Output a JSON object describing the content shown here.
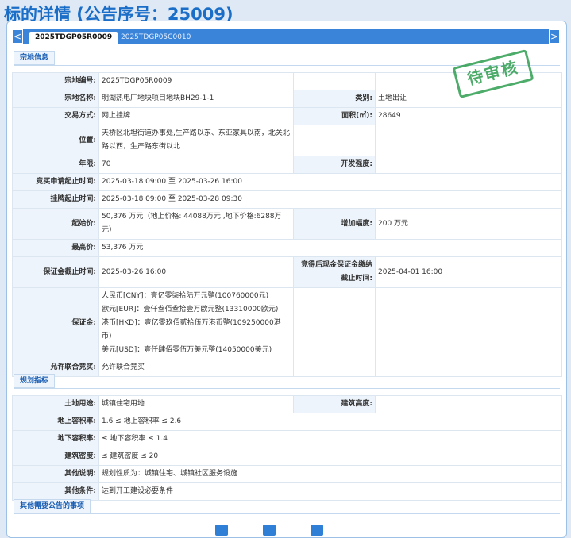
{
  "page_title": "标的详情 (公告序号：25009)",
  "tabs": [
    {
      "label": "2025TDGP05R0009",
      "active": true
    },
    {
      "label": "2025TDGP05C0010",
      "active": false
    }
  ],
  "nav": {
    "prev": "<",
    "next": ">"
  },
  "stamp": "待审核",
  "section1": {
    "title": "宗地信息",
    "plot_no_label": "宗地编号:",
    "plot_no": "2025TDGP05R0009",
    "plot_name_label": "宗地名称:",
    "plot_name": "明湖热电厂地块项目地块BH29-1-1",
    "category_label": "类别:",
    "category": "土地出让",
    "trade_mode_label": "交易方式:",
    "trade_mode": "网上挂牌",
    "area_label": "面积(㎡):",
    "area": "28649",
    "location_label": "位置:",
    "location": "天桥区北坦街道办事处,生产路以东、东亚家具以南，北关北路以西，生产路东街以北",
    "term_label": "年限:",
    "term": "70",
    "dev_intensity_label": "开发强度:",
    "dev_intensity": "",
    "apply_period_label": "竞买申请起止时间:",
    "apply_period": "2025-03-18 09:00 至 2025-03-26 16:00",
    "listing_period_label": "挂牌起止时间:",
    "listing_period": "2025-03-18 09:00 至 2025-03-28 09:30",
    "start_price_label": "起始价:",
    "start_price": "50,376 万元（地上价格: 44088万元 ,地下价格:6288万元）",
    "increment_label": "增加幅度:",
    "increment": "200 万元",
    "max_price_label": "最高价:",
    "max_price": "53,376 万元",
    "deposit_deadline_label": "保证金截止时间:",
    "deposit_deadline": "2025-03-26 16:00",
    "cash_deposit_label": "竞得后现金保证金缴纳截止时间:",
    "cash_deposit": "2025-04-01 16:00",
    "deposit_label": "保证金:",
    "deposit_lines": [
      "人民币[CNY]：壹亿零柒拾陆万元整(100760000元)",
      "欧元[EUR]：壹仟叁佰叁拾壹万欧元整(13310000欧元)",
      "港币[HKD]：壹亿零玖佰贰拾伍万港币整(109250000港币)",
      "美元[USD]：壹仟肆佰零伍万美元整(14050000美元)"
    ],
    "joint_bid_label": "允许联合竞买:",
    "joint_bid": "允许联合竞买"
  },
  "section2": {
    "title": "规划指标",
    "land_use_label": "土地用途:",
    "land_use": "城镇住宅用地",
    "height_label": "建筑高度:",
    "height": "",
    "above_far_label": "地上容积率:",
    "above_far": "1.6 ≤ 地上容积率 ≤ 2.6",
    "below_far_label": "地下容积率:",
    "below_far": "≤ 地下容积率 ≤ 1.4",
    "density_label": "建筑密度:",
    "density": "≤ 建筑密度 ≤ 20",
    "other_note_label": "其他说明:",
    "other_note": "规划性质为：城镇住宅、城镇社区服务设施",
    "other_cond_label": "其他条件:",
    "other_cond": "达到开工建设必要条件"
  },
  "section3": {
    "title": "其他需要公告的事项"
  }
}
